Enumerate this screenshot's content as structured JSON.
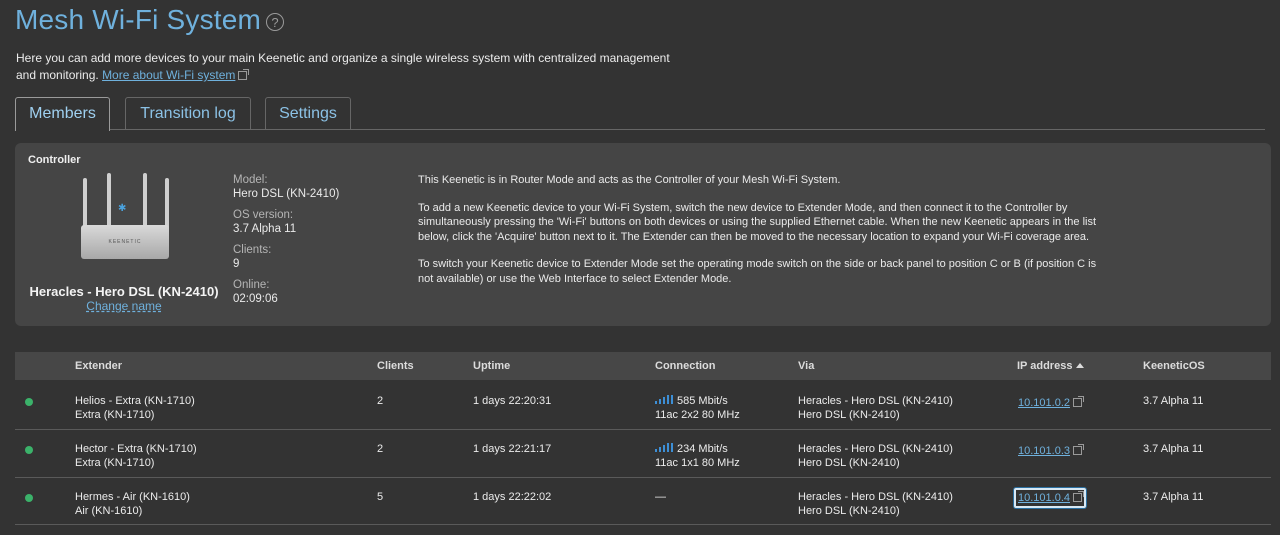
{
  "page": {
    "title": "Mesh Wi-Fi System",
    "help_icon": "?",
    "intro": "Here you can add more devices to your main Keenetic and organize a single wireless system with centralized management and monitoring.",
    "more_link": "More about Wi-Fi system"
  },
  "tabs": [
    {
      "label": "Members",
      "active": true
    },
    {
      "label": "Transition log",
      "active": false
    },
    {
      "label": "Settings",
      "active": false
    }
  ],
  "controller": {
    "section_label": "Controller",
    "router_logo": "KEENETIC",
    "name": "Heracles - Hero DSL (KN-2410)",
    "change_name": "Change name",
    "model_label": "Model:",
    "model": "Hero DSL (KN-2410)",
    "os_label": "OS version:",
    "os": "3.7 Alpha 11",
    "clients_label": "Clients:",
    "clients": "9",
    "online_label": "Online:",
    "online": "02:09:06",
    "text_1": "This Keenetic is in Router Mode and acts as the Controller of your Mesh Wi-Fi System.",
    "text_2": "To add a new Keenetic device to your Wi-Fi System, switch the new device to Extender Mode, and then connect it to the Controller by simultaneously pressing the 'Wi-Fi' buttons on both devices or using the supplied Ethernet cable. When the new Keenetic appears in the list below, click the 'Acquire' button next to it. The Extender can then be moved to the necessary location to expand your Wi-Fi coverage area.",
    "text_3": "To switch your Keenetic device to Extender Mode set the operating mode switch on the side or back panel to position C or B (if position C is not available) or use the Web Interface to select Extender Mode."
  },
  "table": {
    "headers": {
      "extender": "Extender",
      "clients": "Clients",
      "uptime": "Uptime",
      "connection": "Connection",
      "via": "Via",
      "ip": "IP address",
      "os": "KeeneticOS"
    },
    "rows": [
      {
        "name": "Helios - Extra (KN-1710)",
        "model": "Extra (KN-1710)",
        "clients": "2",
        "uptime": "1 days 22:20:31",
        "speed": "585 Mbit/s",
        "mode": "11ac 2x2 80 MHz",
        "via_name": "Heracles - Hero DSL (KN-2410)",
        "via_model": "Hero DSL (KN-2410)",
        "ip": "10.101.0.2",
        "os": "3.7 Alpha 11",
        "status_color": "#3bb26a"
      },
      {
        "name": "Hector - Extra (KN-1710)",
        "model": "Extra (KN-1710)",
        "clients": "2",
        "uptime": "1 days 22:21:17",
        "speed": "234 Mbit/s",
        "mode": "11ac 1x1 80 MHz",
        "via_name": "Heracles - Hero DSL (KN-2410)",
        "via_model": "Hero DSL (KN-2410)",
        "ip": "10.101.0.3",
        "os": "3.7 Alpha 11",
        "status_color": "#3bb26a"
      },
      {
        "name": "Hermes - Air (KN-1610)",
        "model": "Air (KN-1610)",
        "clients": "5",
        "uptime": "1 days 22:22:02",
        "speed": "—",
        "mode": "",
        "via_name": "Heracles - Hero DSL (KN-2410)",
        "via_model": "Hero DSL (KN-2410)",
        "ip": "10.101.0.4",
        "os": "3.7 Alpha 11",
        "status_color": "#3bb26a"
      }
    ]
  },
  "colors": {
    "accent": "#6fb1dd",
    "background": "#333333",
    "panel": "#454545",
    "status_online": "#3bb26a"
  }
}
